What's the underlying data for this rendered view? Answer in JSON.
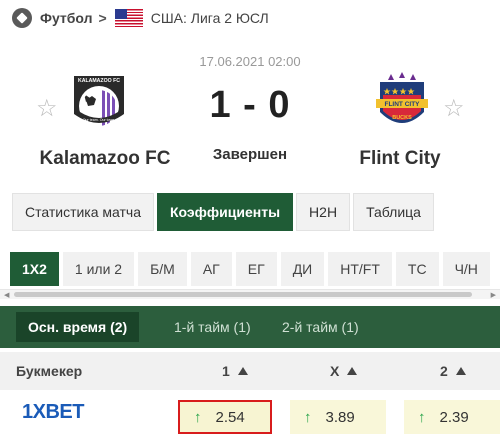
{
  "breadcrumb": {
    "sport": "Футбол",
    "league": "США: Лига 2 ЮСЛ"
  },
  "match": {
    "datetime": "17.06.2021 02:00",
    "home_team": "Kalamazoo FC",
    "away_team": "Flint City",
    "score": "1 - 0",
    "status": "Завершен"
  },
  "home_logo": {
    "top_text": "KALAMAZOO FC",
    "bottom_text": "Our team. Our town."
  },
  "away_logo": {
    "banner": "FLINT CITY",
    "bottom_text": "BUCKS"
  },
  "tabs": [
    {
      "label": "Статистика матча"
    },
    {
      "label": "Коэффициенты"
    },
    {
      "label": "H2H"
    },
    {
      "label": "Таблица"
    }
  ],
  "odds_types": [
    {
      "label": "1X2"
    },
    {
      "label": "1 или 2"
    },
    {
      "label": "Б/М"
    },
    {
      "label": "АГ"
    },
    {
      "label": "ЕГ"
    },
    {
      "label": "ДИ"
    },
    {
      "label": "HT/FT"
    },
    {
      "label": "ТС"
    },
    {
      "label": "Ч/Н"
    }
  ],
  "periods": [
    {
      "label": "Осн. время (2)"
    },
    {
      "label": "1-й тайм (1)"
    },
    {
      "label": "2-й тайм (1)"
    }
  ],
  "table": {
    "headers": {
      "bookmaker": "Букмекер",
      "col1": "1",
      "colx": "X",
      "col2": "2"
    },
    "rows": [
      {
        "bookmaker_logo_text": "1XBET",
        "odd1": "2.54",
        "oddx": "3.89",
        "odd2": "2.39"
      }
    ]
  },
  "colors": {
    "accent_green": "#1f5c36",
    "period_bar": "#2c5e3d",
    "highlight_border": "#d81c1c",
    "up_arrow": "#2aa44a",
    "odd_bg": "#f9f7d9"
  },
  "icons": {
    "sport": "football-icon",
    "flag": "usa-flag-icon",
    "favorite": "star-icon",
    "odds_trend": "arrow-up-icon"
  }
}
